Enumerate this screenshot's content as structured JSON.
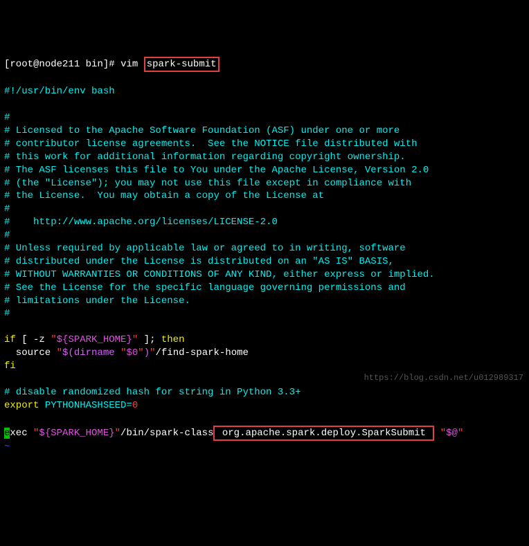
{
  "prompt": {
    "user": "root",
    "host": "node211",
    "dir": "bin",
    "mark": "#",
    "cmd": "vim",
    "arg": "spark-submit"
  },
  "lines": {
    "shebang": "#!/usr/bin/env bash",
    "lic01": "#",
    "lic02": "# Licensed to the Apache Software Foundation (ASF) under one or more",
    "lic03": "# contributor license agreements.  See the NOTICE file distributed with",
    "lic04": "# this work for additional information regarding copyright ownership.",
    "lic05": "# The ASF licenses this file to You under the Apache License, Version 2.0",
    "lic06": "# (the \"License\"); you may not use this file except in compliance with",
    "lic07": "# the License.  You may obtain a copy of the License at",
    "lic08": "#",
    "lic09": "#    http://www.apache.org/licenses/LICENSE-2.0",
    "lic10": "#",
    "lic11": "# Unless required by applicable law or agreed to in writing, software",
    "lic12": "# distributed under the License is distributed on an \"AS IS\" BASIS,",
    "lic13": "# WITHOUT WARRANTIES OR CONDITIONS OF ANY KIND, either express or implied.",
    "lic14": "# See the License for the specific language governing permissions and",
    "lic15": "# limitations under the License.",
    "lic16": "#",
    "if_open_a": "if",
    "if_open_b": " [ -z ",
    "if_open_q1": "\"",
    "if_open_var": "${SPARK_HOME}",
    "if_open_q2": "\"",
    "if_open_c": " ]; ",
    "if_open_then": "then",
    "src_a": "  source ",
    "src_q1": "\"",
    "src_cmd1": "$(",
    "src_cmd2": "dirname ",
    "src_q2": "\"",
    "src_var": "$0",
    "src_q3": "\"",
    "src_cmd3": ")",
    "src_q4": "\"",
    "src_tail": "/find-spark-home",
    "fi": "fi",
    "cmt_hash": "# disable randomized hash for string in Python 3.3+",
    "exp_kw": "export",
    "exp_var": " PYTHONHASHSEED=",
    "exp_val": "0",
    "exec_cursor": "e",
    "exec_a": "xec ",
    "exec_q1": "\"",
    "exec_var": "${SPARK_HOME}",
    "exec_q2": "\"",
    "exec_path": "/bin/spark-class",
    "exec_box": " org.apache.spark.deploy.SparkSubmit ",
    "exec_q3": "\"",
    "exec_argsvar": "$@",
    "exec_q4": "\"",
    "tilde": "~"
  },
  "watermark": "https://blog.csdn.net/u012989317"
}
